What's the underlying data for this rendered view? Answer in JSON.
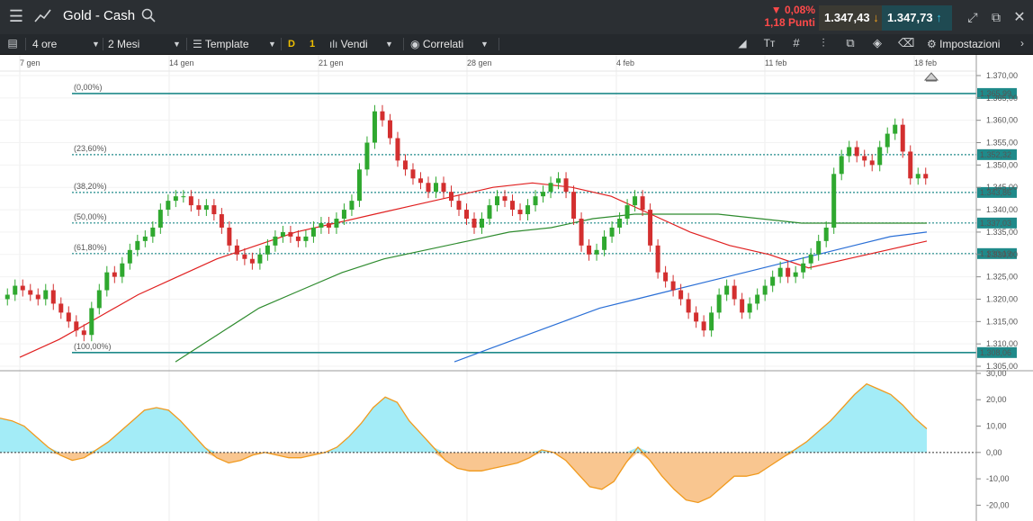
{
  "header": {
    "instrument": "Gold - Cash",
    "change_pct": "▼ 0,08%",
    "change_pts": "1,18 Punti",
    "sell_price": "1.347,43",
    "buy_price": "1.347,73"
  },
  "toolbar": {
    "interval": "4 ore",
    "range": "2 Mesi",
    "template": "Template",
    "d_label": "D",
    "one_label": "1",
    "sell": "Vendi",
    "related": "Correlati",
    "settings": "Impostazioni"
  },
  "colors": {
    "up": "#2fa82f",
    "down": "#d32f2f",
    "fib": "#1f8a8a",
    "ma_red": "#e02020",
    "ma_green": "#2e8b2e",
    "ma_blue": "#2a6fd6",
    "osc_pos": "#a3ecf7",
    "osc_neg": "#f9c690",
    "osc_line": "#f09a1e"
  },
  "chart_data": {
    "type": "candlestick",
    "x_tick_labels": [
      "7 gen",
      "14 gen",
      "21 gen",
      "28 gen",
      "4 feb",
      "11 feb",
      "18 feb"
    ],
    "y_tick_labels": [
      "1.370,00",
      "1.365,00",
      "1.360,00",
      "1.355,00",
      "1.350,00",
      "1.345,00",
      "1.340,00",
      "1.335,00",
      "1.330,00",
      "1.325,00",
      "1.320,00",
      "1.315,00",
      "1.310,00",
      "1.305,00"
    ],
    "ylim": [
      1304,
      1371
    ],
    "fibonacci": [
      {
        "label": "(0,00%)",
        "value": 1365.99,
        "price_label": "1.365,99"
      },
      {
        "label": "(23,60%)",
        "value": 1352.32,
        "price_label": "1.352,32"
      },
      {
        "label": "(38,20%)",
        "value": 1343.86,
        "price_label": "1.343,86"
      },
      {
        "label": "(50,00%)",
        "value": 1337.03,
        "price_label": "1.337,03"
      },
      {
        "label": "(61,80%)",
        "value": 1330.19,
        "price_label": "1.330,19"
      },
      {
        "label": "(100,00%)",
        "value": 1308.06,
        "price_label": "1.308,06"
      }
    ],
    "closes": [
      1321,
      1323,
      1322,
      1321,
      1320,
      1322,
      1319,
      1317,
      1315,
      1313,
      1312,
      1318,
      1322,
      1326,
      1325,
      1328,
      1331,
      1333,
      1334,
      1336,
      1340,
      1342,
      1343,
      1343,
      1341,
      1340,
      1341,
      1339,
      1336,
      1332,
      1330,
      1329,
      1328,
      1330,
      1332,
      1334,
      1335,
      1334,
      1333,
      1334,
      1336,
      1337,
      1336,
      1338,
      1340,
      1342,
      1349,
      1355,
      1362,
      1360,
      1356,
      1351,
      1349,
      1347,
      1346,
      1344,
      1346,
      1344,
      1342,
      1340,
      1338,
      1336,
      1338,
      1341,
      1343,
      1342,
      1340,
      1339,
      1341,
      1343,
      1344,
      1346,
      1347,
      1344,
      1338,
      1332,
      1330,
      1331,
      1334,
      1336,
      1338,
      1341,
      1343,
      1340,
      1332,
      1326,
      1324,
      1322,
      1320,
      1317,
      1315,
      1313,
      1317,
      1321,
      1323,
      1320,
      1317,
      1319,
      1321,
      1323,
      1325,
      1327,
      1325,
      1326,
      1328,
      1330,
      1333,
      1336,
      1348,
      1352,
      1354,
      1352,
      1351,
      1350,
      1354,
      1357,
      1359,
      1353,
      1347,
      1348,
      1347
    ],
    "moving_averages": {
      "red": [
        1307,
        1311,
        1316,
        1321,
        1325,
        1329,
        1332,
        1335,
        1337,
        1339,
        1341,
        1343,
        1345,
        1346,
        1345,
        1343,
        1339,
        1335,
        1332,
        1330,
        1327,
        1329,
        1331,
        1333
      ],
      "green": [
        1306,
        1312,
        1318,
        1322,
        1326,
        1329,
        1331,
        1333,
        1335,
        1336,
        1338,
        1339,
        1339,
        1339,
        1338,
        1337,
        1337,
        1337,
        1337
      ],
      "blue": [
        1306,
        1309,
        1312,
        1315,
        1318,
        1320,
        1322,
        1324,
        1326,
        1328,
        1330,
        1332,
        1334,
        1335
      ]
    },
    "oscillator": {
      "y_tick_labels": [
        "30,00",
        "20,00",
        "10,00",
        "0,00",
        "-10,00",
        "-20,00"
      ],
      "ylim": [
        -26,
        31
      ],
      "values": [
        13,
        12,
        10,
        6,
        2,
        -1,
        -3,
        -2,
        1,
        4,
        8,
        12,
        16,
        17,
        16,
        12,
        7,
        2,
        -2,
        -4,
        -3,
        -1,
        0,
        -1,
        -2,
        -2,
        -1,
        0,
        2,
        6,
        11,
        17,
        21,
        19,
        12,
        7,
        2,
        -3,
        -6,
        -7,
        -7,
        -6,
        -5,
        -4,
        -2,
        1,
        0,
        -3,
        -8,
        -13,
        -14,
        -11,
        -4,
        2,
        -3,
        -9,
        -14,
        -18,
        -19,
        -17,
        -13,
        -9,
        -9,
        -8,
        -5,
        -2,
        1,
        4,
        8,
        12,
        17,
        22,
        26,
        24,
        22,
        18,
        13,
        9
      ]
    }
  }
}
